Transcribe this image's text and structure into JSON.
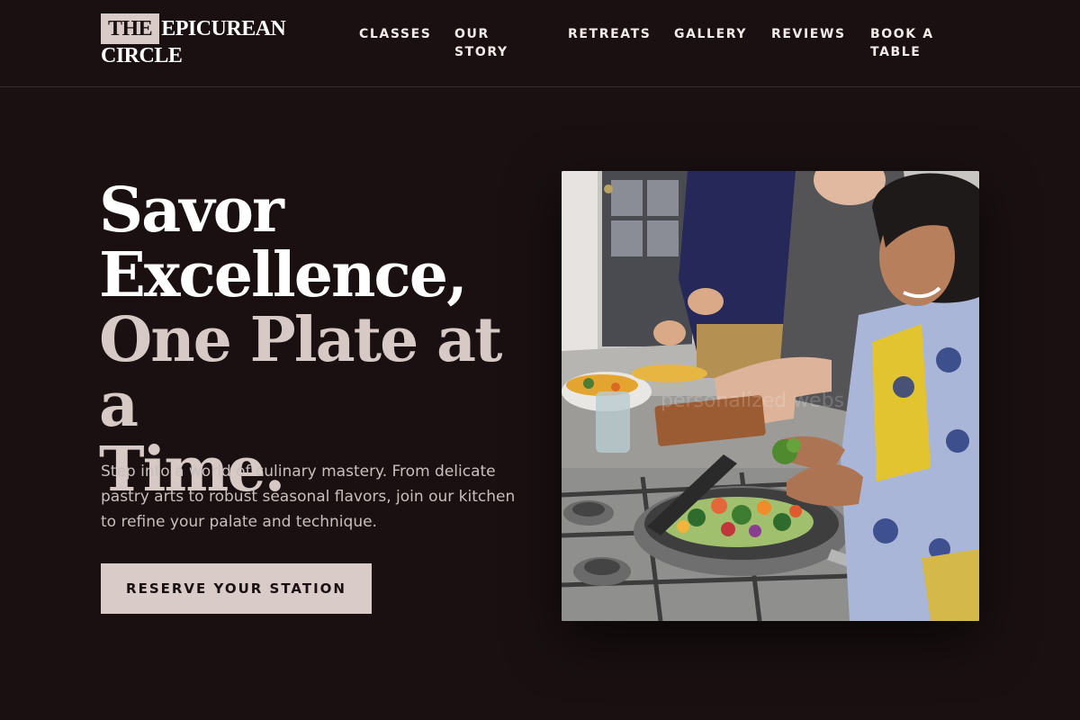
{
  "brand": {
    "logo_box_text": "THE",
    "logo_line1_rest": "EPICUREAN",
    "logo_line2": "CIRCLE"
  },
  "nav": {
    "items": [
      {
        "label": "CLASSES"
      },
      {
        "label": "OUR STORY"
      },
      {
        "label": "RETREATS"
      },
      {
        "label": "GALLERY"
      },
      {
        "label": "REVIEWS"
      },
      {
        "label": "BOOK A TABLE"
      }
    ]
  },
  "hero": {
    "title_line1": "Savor",
    "title_line2": "Excellence,",
    "title_line3": "One Plate at a",
    "title_line4": "Time.",
    "description": "Step into a world of culinary mastery. From delicate pastry arts to robust seasonal flavors, join our kitchen to refine your palate and technique.",
    "cta_label": "RESERVE YOUR STATION"
  },
  "photo": {
    "watermark": "personalized webs"
  },
  "colors": {
    "background": "#1a1011",
    "accent": "#d9cbc8",
    "title_blush": "#d6c9c6",
    "body_text": "#c9bfbd"
  }
}
